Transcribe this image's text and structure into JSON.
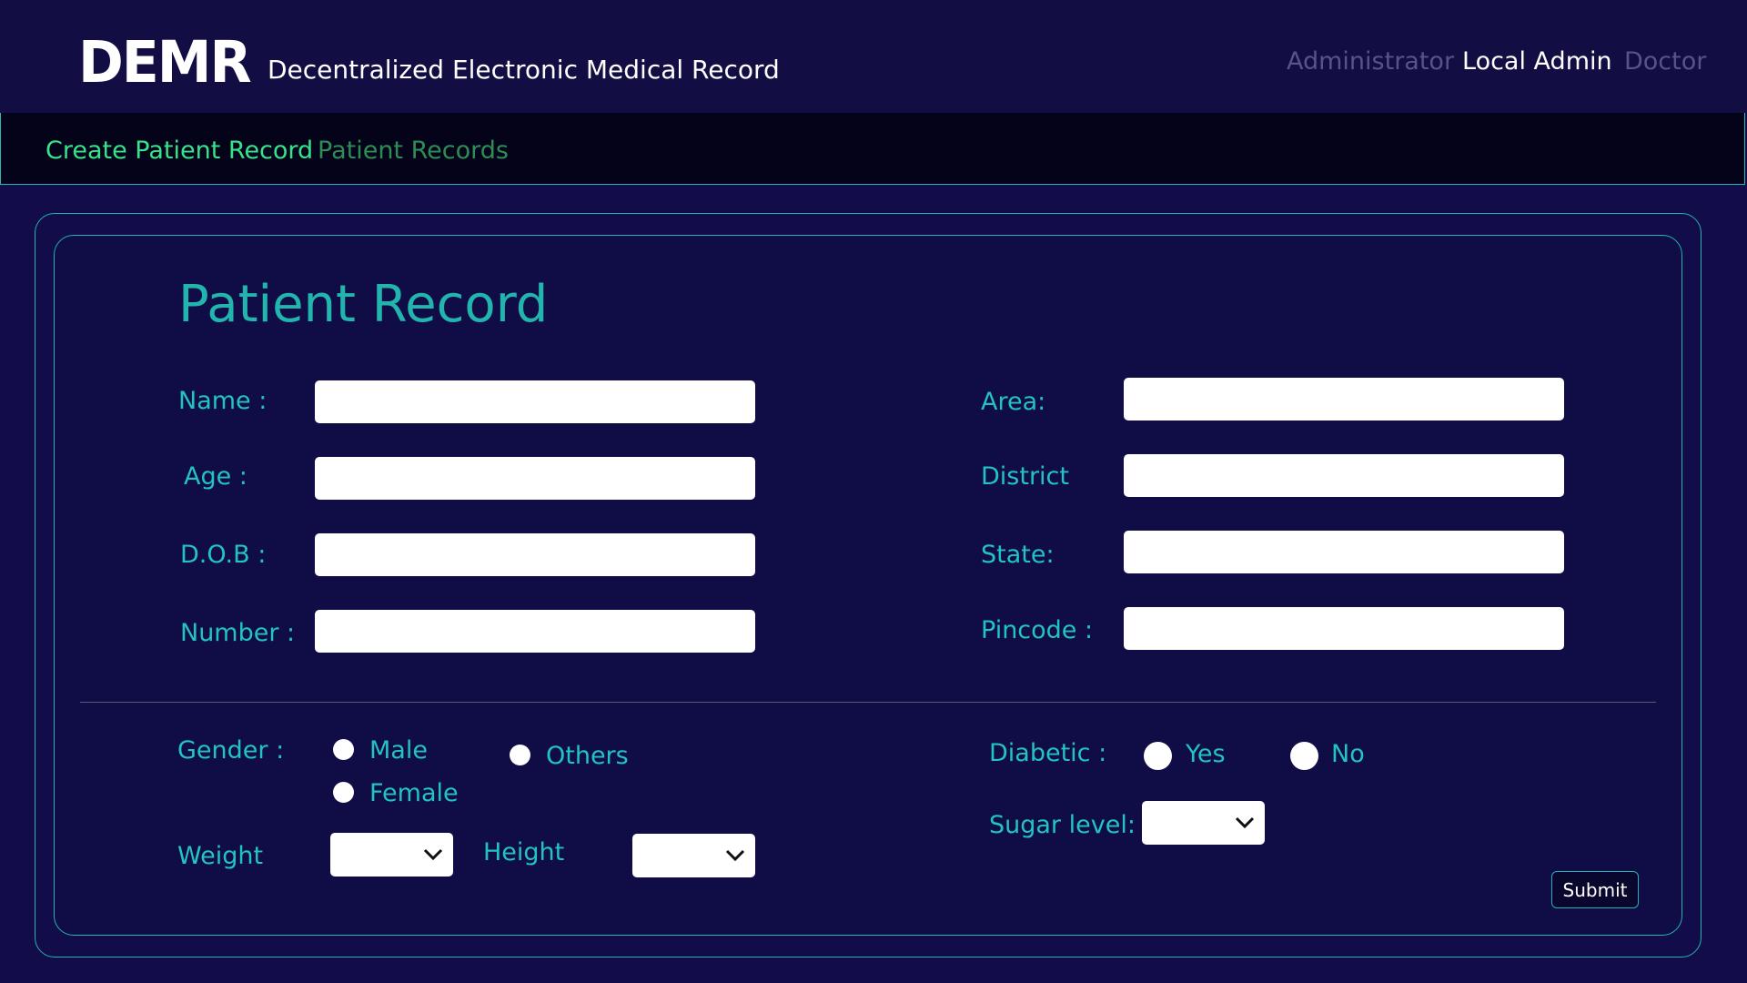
{
  "header": {
    "logo": "DEMR",
    "subtitle": "Decentralized Electronic Medical Record",
    "roles": [
      "Administrator",
      "Local Admin",
      "Doctor"
    ]
  },
  "subnav": {
    "items": [
      "Create Patient Record",
      "Patient Records"
    ]
  },
  "form": {
    "title": "Patient Record",
    "left_labels": [
      "Name :",
      "Age :",
      "D.O.B :",
      "Number :"
    ],
    "right_labels": [
      "Area:",
      "District",
      "State:",
      "Pincode :"
    ],
    "gender": {
      "label": "Gender :",
      "options": [
        "Male",
        "Others",
        "Female"
      ]
    },
    "diabetic": {
      "label": "Diabetic :",
      "options": [
        "Yes",
        "No"
      ]
    },
    "weight_label": "Weight",
    "height_label": "Height",
    "sugar_label": "Sugar level:",
    "submit_label": "Submit"
  },
  "colors": {
    "accent": "#22c3c0",
    "active_nav": "#37e38a",
    "inactive_nav": "#2e8c55",
    "background": "#120d4a"
  }
}
